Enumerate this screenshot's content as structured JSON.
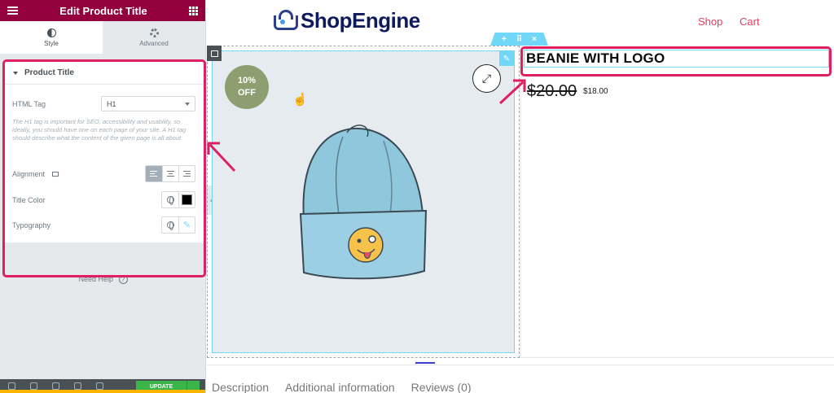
{
  "panel": {
    "header_title": "Edit Product Title",
    "tabs": [
      {
        "label": "Style",
        "icon": "contrast-icon",
        "active": true
      },
      {
        "label": "Advanced",
        "icon": "gear-icon",
        "active": false
      }
    ],
    "section_title": "Product Title",
    "html_tag": {
      "label": "HTML Tag",
      "value": "H1"
    },
    "description": "The H1 tag is important for SEO, accessibility and usability, so ideally, you should have one on each page of your site. A H1 tag should describe what the content of the given page is all about",
    "alignment": {
      "label": "Alignment",
      "selected": "left"
    },
    "title_color": {
      "label": "Title Color",
      "value": "#000000"
    },
    "typography": {
      "label": "Typography"
    },
    "need_help": "Need Help",
    "update_label": "UPDATE"
  },
  "site": {
    "logo_text": "ShopEngine",
    "nav": [
      "Shop",
      "Cart"
    ]
  },
  "product": {
    "sale_badge_line1": "10%",
    "sale_badge_line2": "OFF",
    "title": "BEANIE WITH LOGO",
    "price_old": "$20.00",
    "price_new": "$18.00"
  },
  "product_tabs": [
    "Description",
    "Additional information",
    "Reviews (0)"
  ],
  "colors": {
    "panel_header": "#93003c",
    "annotation": "#e01f63",
    "widget_handle": "#71d7f7",
    "nav_link": "#e0405f",
    "badge": "#8d9f70"
  }
}
